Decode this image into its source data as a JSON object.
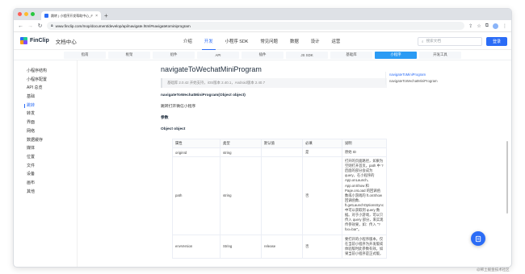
{
  "browser": {
    "tab_title": "跳转 | 小程序开发帮助中心_Fi...",
    "url": "www.finclip.com/mop/document/develop/api/navigate.html#navigatetominiprogram",
    "traffic_colors": [
      "#ff5f57",
      "#febc2e",
      "#28c840"
    ]
  },
  "header": {
    "logo_text": "FinClip",
    "doc_center": "文档中心",
    "nav": [
      "介绍",
      "开发",
      "小程序 SDK",
      "常见问题",
      "数据",
      "设计",
      "运营"
    ],
    "active_nav": 1,
    "search_placeholder": "搜索文档",
    "login": "登录"
  },
  "subnav": {
    "items": [
      "指南",
      "框架",
      "组件",
      "API",
      "插件",
      "JS SDK",
      "基础库",
      "小程序",
      "开发工具"
    ],
    "active": 7
  },
  "sidebar": {
    "items": [
      "小程序结构",
      "小程序配置",
      "API 总览",
      "基础",
      "跳转",
      "转发",
      "界面",
      "网络",
      "数据缓存",
      "媒体",
      "位置",
      "文件",
      "设备",
      "画布",
      "其他"
    ],
    "active": 4
  },
  "main": {
    "title": "navigateToWechatMiniProgram",
    "version_note": "基础库 2.0.42 开始支持，iOS版本 2.40.1，Android版本 2.40.7",
    "signature": "navigateToWechatMiniProgram(Object object)",
    "desc": "跳转打开微信小程序",
    "params_label": "参数",
    "object_label": "Object object",
    "table": {
      "headers": [
        "属性",
        "类型",
        "默认值",
        "必填",
        "说明"
      ],
      "rows": [
        {
          "name": "originId",
          "type": "string",
          "default": "",
          "required": "是",
          "desc": "原始 ID"
        },
        {
          "name": "path",
          "type": "string",
          "default": "",
          "required": "否",
          "desc": "打开的页面路径，如果为空则打开首页。path 中 ? 后面的部分会成为 query，在小程序的 App.onLaunch、App.onShow 和 Page.onLoad 的回调函数或小游戏的 ft.onShow 回调函数、ft.getLaunchOptionsSync 中可以获取到 query 数据。对于小游戏，可以只传入 query 部分，来实现传参效果，如：传入 \"?foo=bar\"。"
        },
        {
          "name": "envVersion",
          "type": "String",
          "default": "release",
          "required": "否",
          "desc": "要打开的小程序版本。仅在当前小程序为开发版或体验版时此参数有效。如果当前小程序是正式版，"
        }
      ]
    }
  },
  "toc": {
    "items": [
      "navigateToMiniProgram",
      "navigateToWechatMiniProgram"
    ],
    "active": 0
  },
  "icons": {
    "float_button": "edit-icon"
  },
  "watermark": "@稀土掘金技术社区"
}
